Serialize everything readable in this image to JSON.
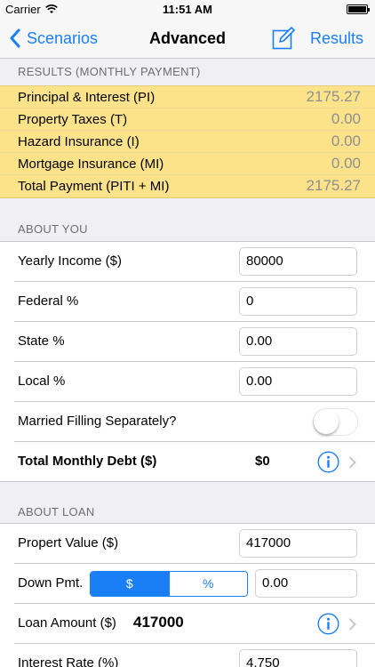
{
  "status_bar": {
    "carrier": "Carrier",
    "time": "11:51 AM"
  },
  "nav": {
    "back_label": "Scenarios",
    "title": "Advanced",
    "results_label": "Results",
    "accent": "#1a7ff7"
  },
  "results": {
    "header": "RESULTS (MONTHLY PAYMENT)",
    "rows": [
      {
        "label": "Principal & Interest (PI)",
        "value": "2175.27"
      },
      {
        "label": "Property Taxes (T)",
        "value": "0.00"
      },
      {
        "label": "Hazard Insurance (I)",
        "value": "0.00"
      },
      {
        "label": "Mortgage Insurance (MI)",
        "value": "0.00"
      },
      {
        "label": "Total Payment (PITI + MI)",
        "value": "2175.27"
      }
    ],
    "highlight_color": "#fce38a"
  },
  "about_you": {
    "header": "ABOUT YOU",
    "yearly_income": {
      "label": "Yearly Income ($)",
      "value": "80000"
    },
    "federal": {
      "label": "Federal %",
      "value": "0"
    },
    "state": {
      "label": "State %",
      "value": "0.00"
    },
    "local": {
      "label": "Local %",
      "value": "0.00"
    },
    "married": {
      "label": "Married Filling Separately?",
      "on": false
    },
    "total_debt": {
      "label": "Total Monthly Debt ($)",
      "value": "$0"
    }
  },
  "about_loan": {
    "header": "ABOUT LOAN",
    "property_value": {
      "label": "Propert Value ($)",
      "value": "417000"
    },
    "down_pmt": {
      "label": "Down Pmt.",
      "options": [
        "$",
        "%"
      ],
      "selected": "$",
      "value": "0.00"
    },
    "loan_amount": {
      "label": "Loan Amount ($)",
      "value": "417000"
    },
    "interest_rate": {
      "label": "Interest Rate (%)",
      "value": "4.750"
    }
  }
}
